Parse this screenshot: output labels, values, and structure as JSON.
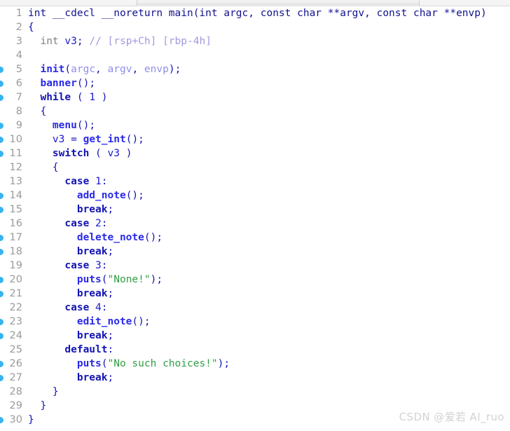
{
  "window": {
    "view_name": "pseudocode-view",
    "background": "#ffffff"
  },
  "palette": {
    "declaration": "#12128f",
    "keyword": "#1414b4",
    "type": "#808080",
    "function": "#2a2ae8",
    "variable": "#1a1ad0",
    "variable_faded": "#8f8fe8",
    "number": "#1a1ad0",
    "string": "#2f9e44",
    "comment": "#a09ae0",
    "line_number": "#9a9a9a",
    "marker": "#36b4ef",
    "gutter_rule": "#d9d9d9",
    "watermark": "#d2d2d2"
  },
  "gutter": {
    "first_line_number": 1,
    "last_line_number": 30,
    "total_lines": 30
  },
  "code": {
    "language": "c",
    "function_name": "main",
    "lines": [
      {
        "number": "1",
        "marker": false,
        "indent": 0,
        "text": "int __cdecl __noreturn main(int argc, const char **argv, const char **envp)"
      },
      {
        "number": "2",
        "marker": false,
        "indent": 0,
        "text": "{"
      },
      {
        "number": "3",
        "marker": false,
        "indent": 1,
        "text": "int v3; // [rsp+Ch] [rbp-4h]"
      },
      {
        "number": "4",
        "marker": false,
        "indent": 0,
        "text": ""
      },
      {
        "number": "5",
        "marker": true,
        "indent": 1,
        "text": "init(argc, argv, envp);"
      },
      {
        "number": "6",
        "marker": true,
        "indent": 1,
        "text": "banner();"
      },
      {
        "number": "7",
        "marker": true,
        "indent": 1,
        "text": "while ( 1 )"
      },
      {
        "number": "8",
        "marker": false,
        "indent": 1,
        "text": "{"
      },
      {
        "number": "9",
        "marker": true,
        "indent": 2,
        "text": "menu();"
      },
      {
        "number": "10",
        "marker": true,
        "indent": 2,
        "text": "v3 = get_int();"
      },
      {
        "number": "11",
        "marker": true,
        "indent": 2,
        "text": "switch ( v3 )"
      },
      {
        "number": "12",
        "marker": false,
        "indent": 2,
        "text": "{"
      },
      {
        "number": "13",
        "marker": false,
        "indent": 3,
        "text": "case 1:"
      },
      {
        "number": "14",
        "marker": true,
        "indent": 4,
        "text": "add_note();"
      },
      {
        "number": "15",
        "marker": true,
        "indent": 4,
        "text": "break;"
      },
      {
        "number": "16",
        "marker": false,
        "indent": 3,
        "text": "case 2:"
      },
      {
        "number": "17",
        "marker": true,
        "indent": 4,
        "text": "delete_note();"
      },
      {
        "number": "18",
        "marker": true,
        "indent": 4,
        "text": "break;"
      },
      {
        "number": "19",
        "marker": false,
        "indent": 3,
        "text": "case 3:"
      },
      {
        "number": "20",
        "marker": true,
        "indent": 4,
        "text": "puts(\"None!\");"
      },
      {
        "number": "21",
        "marker": true,
        "indent": 4,
        "text": "break;"
      },
      {
        "number": "22",
        "marker": false,
        "indent": 3,
        "text": "case 4:"
      },
      {
        "number": "23",
        "marker": true,
        "indent": 4,
        "text": "edit_note();"
      },
      {
        "number": "24",
        "marker": true,
        "indent": 4,
        "text": "break;"
      },
      {
        "number": "25",
        "marker": false,
        "indent": 3,
        "text": "default:"
      },
      {
        "number": "26",
        "marker": true,
        "indent": 4,
        "text": "puts(\"No such choices!\");"
      },
      {
        "number": "27",
        "marker": true,
        "indent": 4,
        "text": "break;"
      },
      {
        "number": "28",
        "marker": false,
        "indent": 2,
        "text": "}"
      },
      {
        "number": "29",
        "marker": false,
        "indent": 1,
        "text": "}"
      },
      {
        "number": "30",
        "marker": true,
        "indent": 0,
        "text": "}"
      }
    ],
    "tokens": {
      "calls": [
        "init",
        "banner",
        "menu",
        "get_int",
        "add_note",
        "delete_note",
        "puts",
        "edit_note"
      ],
      "locals": [
        "v3"
      ],
      "parameters": [
        "argc",
        "argv",
        "envp"
      ],
      "strings": [
        "None!",
        "No such choices!"
      ],
      "comments": [
        "// [rsp+Ch] [rbp-4h]"
      ],
      "keywords": [
        "while",
        "switch",
        "case",
        "break",
        "default",
        "int",
        "const",
        "char"
      ],
      "calling_convention": "__cdecl",
      "attributes": "__noreturn"
    }
  },
  "watermark": {
    "text": "CSDN @爱若 AI_ruo"
  }
}
